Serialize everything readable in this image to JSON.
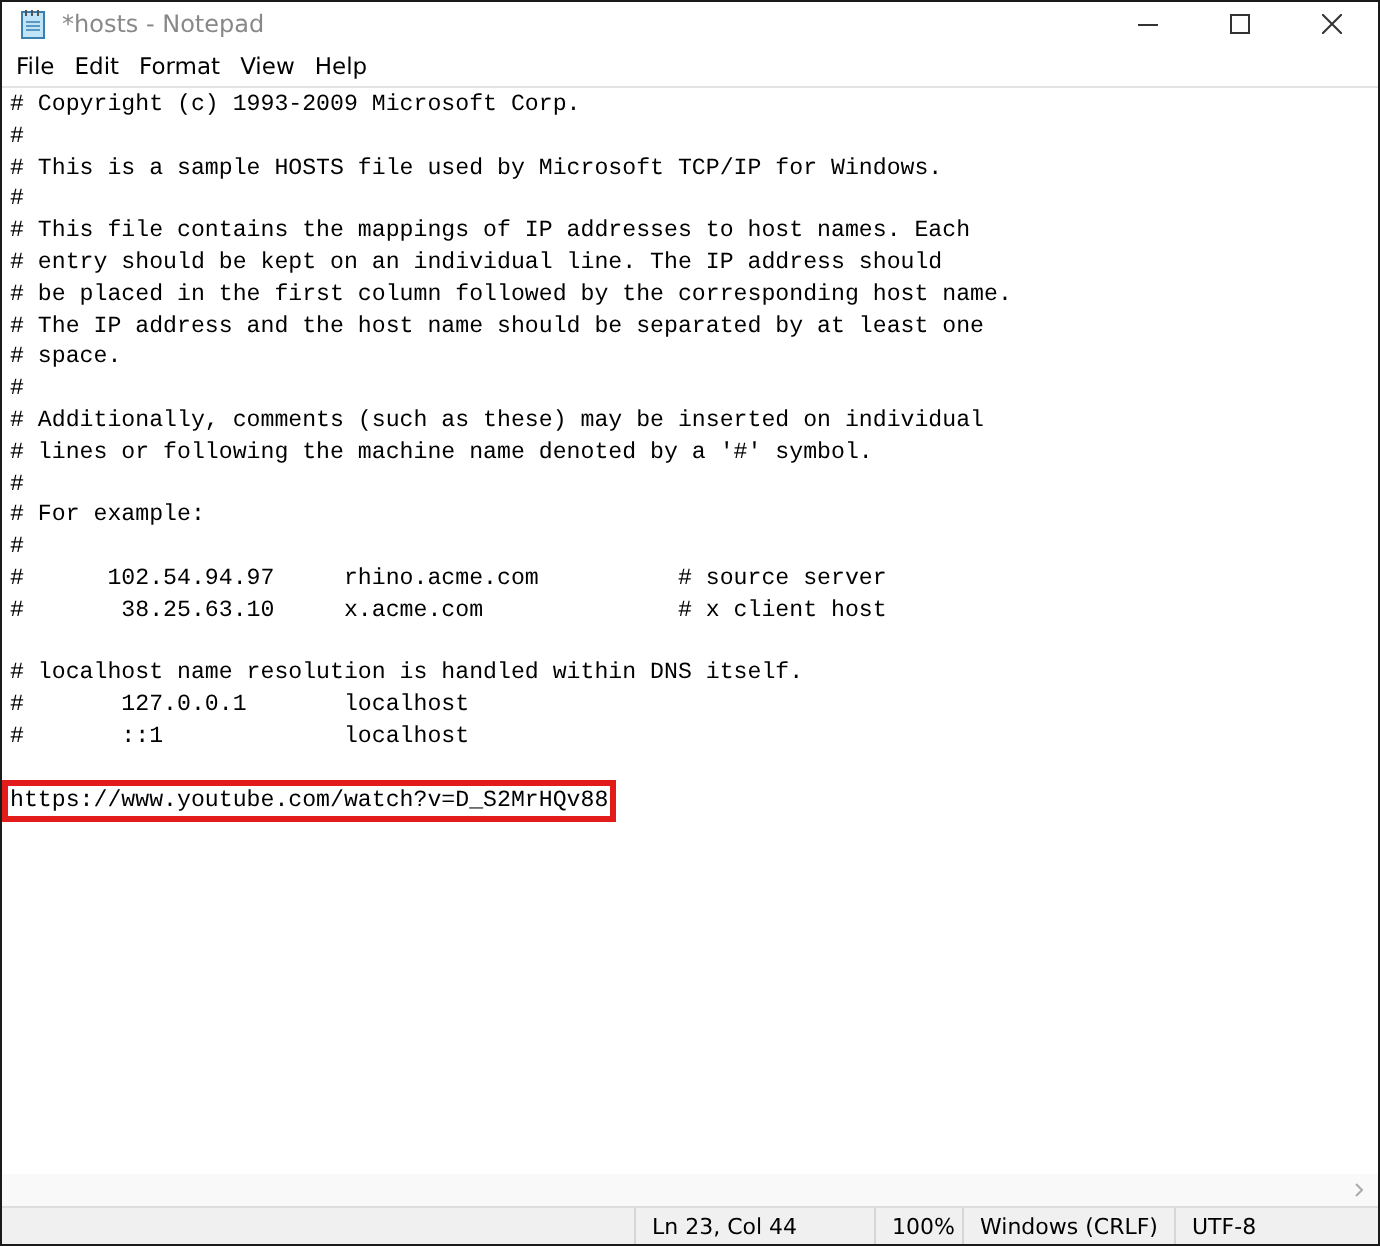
{
  "window": {
    "title": "*hosts - Notepad"
  },
  "menu": [
    "File",
    "Edit",
    "Format",
    "View",
    "Help"
  ],
  "lines": [
    {
      "kind": "text",
      "text": "# Copyright (c) 1993-2009 Microsoft Corp."
    },
    {
      "kind": "text",
      "text": "#"
    },
    {
      "kind": "text",
      "text": "# This is a sample HOSTS file used by Microsoft TCP/IP for Windows."
    },
    {
      "kind": "text",
      "text": "#"
    },
    {
      "kind": "text",
      "text": "# This file contains the mappings of IP addresses to host names. Each"
    },
    {
      "kind": "text",
      "text": "# entry should be kept on an individual line. The IP address should"
    },
    {
      "kind": "text",
      "text": "# be placed in the first column followed by the corresponding host name."
    },
    {
      "kind": "text",
      "text": "# The IP address and the host name should be separated by at least one"
    },
    {
      "kind": "text",
      "text": "# space."
    },
    {
      "kind": "text",
      "text": "#"
    },
    {
      "kind": "text",
      "text": "# Additionally, comments (such as these) may be inserted on individual"
    },
    {
      "kind": "text",
      "text": "# lines or following the machine name denoted by a '#' symbol."
    },
    {
      "kind": "text",
      "text": "#"
    },
    {
      "kind": "text",
      "text": "# For example:"
    },
    {
      "kind": "text",
      "text": "#"
    },
    {
      "kind": "text",
      "text": "#      102.54.94.97     rhino.acme.com          # source server"
    },
    {
      "kind": "text",
      "text": "#       38.25.63.10     x.acme.com              # x client host"
    },
    {
      "kind": "blank"
    },
    {
      "kind": "text",
      "text": "# localhost name resolution is handled within DNS itself."
    },
    {
      "kind": "text",
      "text": "#       127.0.0.1       localhost"
    },
    {
      "kind": "text",
      "text": "#       ::1             localhost"
    },
    {
      "kind": "blank"
    },
    {
      "kind": "text",
      "text": "https://www.youtube.com/watch?v=D_S2MrHQv88",
      "highlighted": true
    }
  ],
  "status_bar": [
    "Ln 23, Col 44",
    "100%",
    "Windows (CRLF)",
    "UTF-8"
  ]
}
